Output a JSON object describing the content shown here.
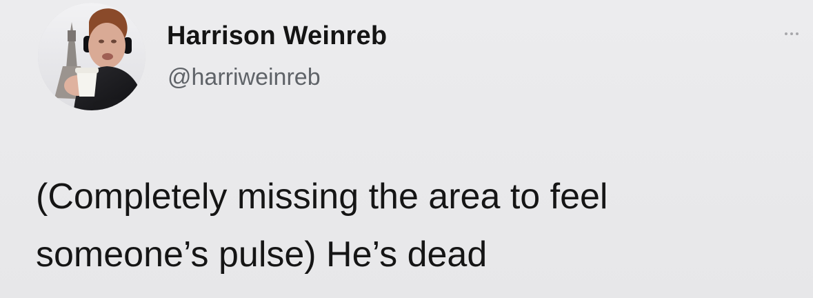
{
  "author": {
    "display_name": "Harrison Weinreb",
    "handle": "@harriweinreb",
    "avatar": "profile-photo"
  },
  "tweet": {
    "text": "(Completely missing the area to feel someone’s pulse) He’s dead"
  },
  "menu": {
    "icon": "more-options-icon"
  },
  "colors": {
    "background": "#e9e9eb",
    "text": "#151515",
    "handle": "#5f6368"
  }
}
